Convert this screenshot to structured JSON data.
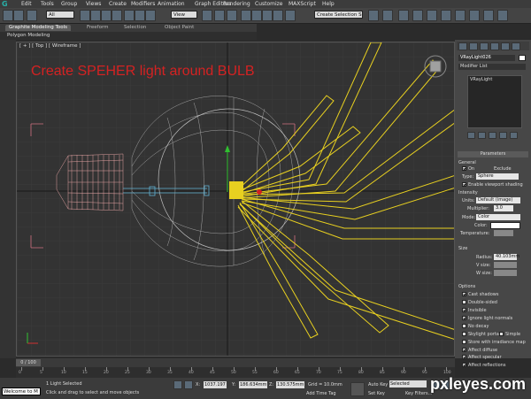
{
  "menubar": {
    "items": [
      "Edit",
      "Tools",
      "Group",
      "Views",
      "Create",
      "Modifiers",
      "Animation",
      "Graph Editors",
      "Rendering",
      "Customize",
      "MAXScript",
      "Help"
    ]
  },
  "toolbar": {
    "filter_value": "All",
    "refcoord_value": "View",
    "selection_set": "Create Selection S"
  },
  "ribbon": {
    "tabs": [
      "Graphite Modeling Tools",
      "Freeform",
      "Selection",
      "Object Paint"
    ],
    "sub_label": "Polygon Modeling"
  },
  "viewport": {
    "label": "[ + ] [ Top ] [ Wireframe ]",
    "title": "Create SPEHER light around BULB"
  },
  "command_panel": {
    "object_name": "VRayLight026",
    "modifier_list": "Modifier List",
    "stack_item": "VRayLight",
    "rollout_title": "Parameters",
    "general_label": "General",
    "on_label": "On",
    "exclude_label": "Exclude",
    "type_label": "Type:",
    "type_value": "Sphere",
    "viewport_shading": "Enable viewport shading",
    "intensity_label": "Intensity",
    "units_label": "Units:",
    "units_value": "Default (image)",
    "multiplier_label": "Multiplier:",
    "multiplier_value": "3.0",
    "mode_label": "Mode:",
    "mode_value": "Color",
    "color_label": "Color:",
    "temperature_label": "Temperature:",
    "size_label": "Size",
    "radius_label": "Radius:",
    "radius_value": "40.103mm",
    "vsize_label": "V size:",
    "wsize_label": "W size:",
    "options_label": "Options",
    "options": [
      {
        "label": "Cast shadows",
        "checked": true
      },
      {
        "label": "Double-sided",
        "checked": false
      },
      {
        "label": "Invisible",
        "checked": true
      },
      {
        "label": "Ignore light normals",
        "checked": true
      },
      {
        "label": "No decay",
        "checked": false
      },
      {
        "label": "Skylight portal",
        "checked": false
      },
      {
        "label": "Store with irradiance map",
        "checked": false
      },
      {
        "label": "Affect diffuse",
        "checked": true
      },
      {
        "label": "Affect specular",
        "checked": true
      },
      {
        "label": "Affect reflections",
        "checked": true
      }
    ],
    "simple_label": "Simple"
  },
  "timeline": {
    "frame_display": "0 / 100",
    "ticks": [
      "0",
      "5",
      "10",
      "15",
      "20",
      "25",
      "30",
      "35",
      "40",
      "45",
      "50",
      "55",
      "60",
      "65",
      "70",
      "75",
      "80",
      "85",
      "90",
      "95",
      "100"
    ]
  },
  "status": {
    "maxscript": "Welcome to M",
    "selection": "1 Light Selected",
    "prompt": "Click and drag to select and move objects",
    "x_label": "X:",
    "x_value": "1037.197",
    "y_label": "Y:",
    "y_value": "186.634mm",
    "z_label": "Z:",
    "z_value": "130.575mm",
    "grid": "Grid = 10.0mm",
    "auto_key": "Auto Key",
    "auto_key_value": "Selected",
    "set_key": "Set Key",
    "key_filters": "Key Filters...",
    "add_time_tag": "Add Time Tag",
    "watermark": "pxleyes.com"
  }
}
